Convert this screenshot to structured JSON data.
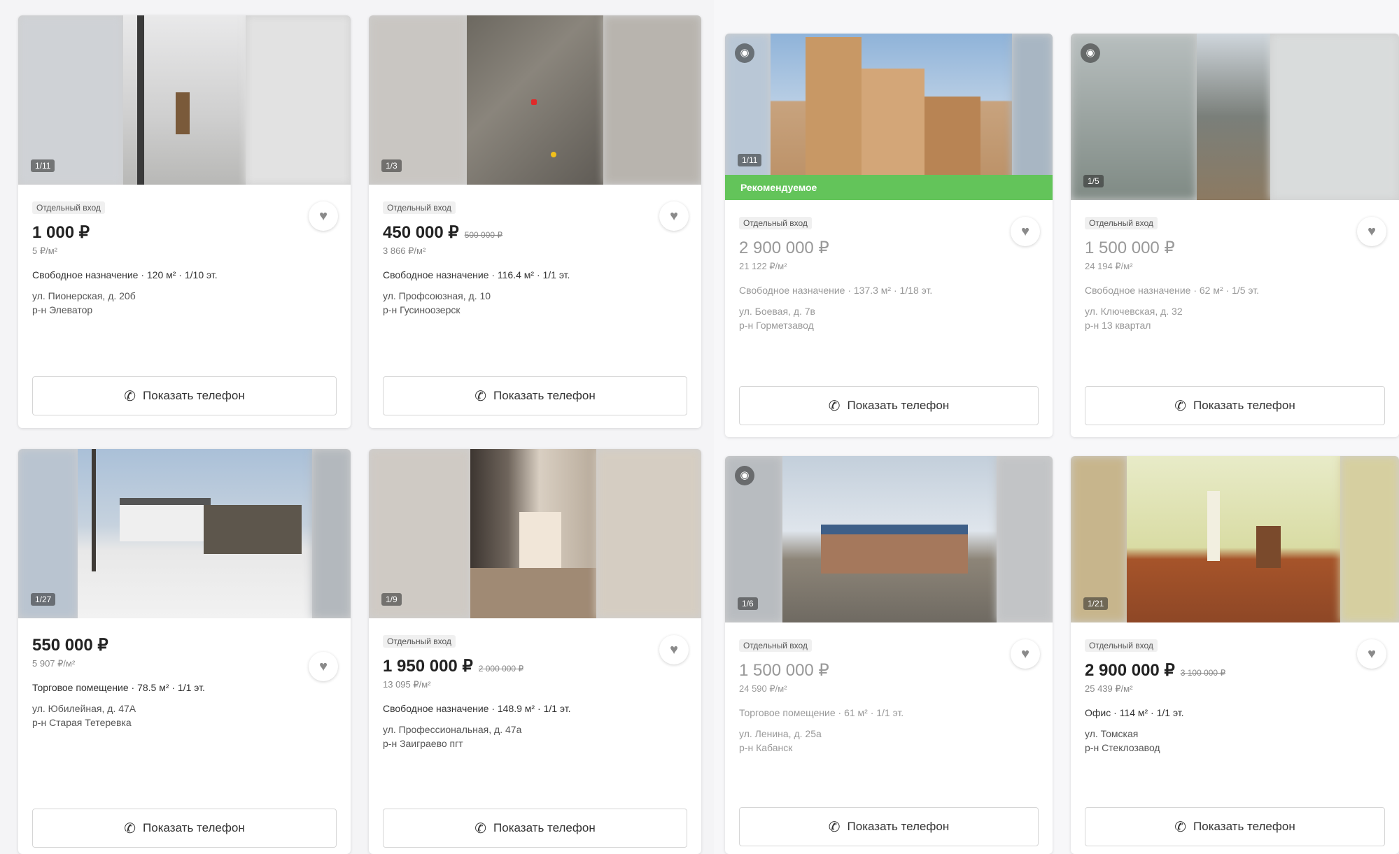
{
  "labels": {
    "tag": "Отдельный вход",
    "show_phone": "Показать телефон",
    "recommended": "Рекомендуемое"
  },
  "left_cards": [
    {
      "counter": "1/11",
      "price": "1 000 ₽",
      "old_price": "",
      "price_per_m2": "5 ₽/м²",
      "specs": "Свободное назначение · 120 м² · 1/10 эт.",
      "street": "ул. Пионерская, д. 20б",
      "district": "р-н Элеватор",
      "show_tag": true
    },
    {
      "counter": "1/3",
      "price": "450 000 ₽",
      "old_price": "500 000 ₽",
      "price_per_m2": "3 866 ₽/м²",
      "specs": "Свободное назначение · 116.4 м² · 1/1 эт.",
      "street": "ул. Профсоюзная, д. 10",
      "district": "р-н Гусиноозерск",
      "show_tag": true
    },
    {
      "counter": "1/27",
      "price": "550 000 ₽",
      "old_price": "",
      "price_per_m2": "5 907 ₽/м²",
      "specs": "Торговое помещение · 78.5 м² · 1/1 эт.",
      "street": "ул. Юбилейная, д. 47А",
      "district": "р-н Старая Тетеревка",
      "show_tag": false
    },
    {
      "counter": "1/9",
      "price": "1 950 000 ₽",
      "old_price": "2 000 000 ₽",
      "price_per_m2": "13 095 ₽/м²",
      "specs": "Свободное назначение · 148.9 м² · 1/1 эт.",
      "street": "ул. Профессиональная, д. 47а",
      "district": "р-н Заиграево пгт",
      "show_tag": true
    }
  ],
  "right_cards": [
    {
      "counter": "1/11",
      "price": "2 900 000 ₽",
      "old_price": "",
      "price_per_m2": "21 122 ₽/м²",
      "specs": "Свободное назначение · 137.3 м² · 1/18 эт.",
      "street": "ул. Боевая, д. 7в",
      "district": "р-н Горметзавод",
      "show_tag": true,
      "promo": true,
      "eye": true
    },
    {
      "counter": "1/5",
      "price": "1 500 000 ₽",
      "old_price": "",
      "price_per_m2": "24 194 ₽/м²",
      "specs": "Свободное назначение · 62 м² · 1/5 эт.",
      "street": "ул. Ключевская, д. 32",
      "district": "р-н 13 квартал",
      "show_tag": true,
      "promo": false,
      "eye": true
    },
    {
      "counter": "1/6",
      "price": "1 500 000 ₽",
      "old_price": "",
      "price_per_m2": "24 590 ₽/м²",
      "specs": "Торговое помещение · 61 м² · 1/1 эт.",
      "street": "ул. Ленина, д. 25а",
      "district": "р-н Кабанск",
      "show_tag": true,
      "promo": false,
      "eye": true
    },
    {
      "counter": "1/21",
      "price": "2 900 000 ₽",
      "old_price": "3 100 000 ₽",
      "price_per_m2": "25 439 ₽/м²",
      "specs": "Офис · 114 м² · 1/1 эт.",
      "street": "ул. Томская",
      "district": "р-н Стеклозавод",
      "show_tag": true,
      "promo": false,
      "eye": false
    }
  ]
}
